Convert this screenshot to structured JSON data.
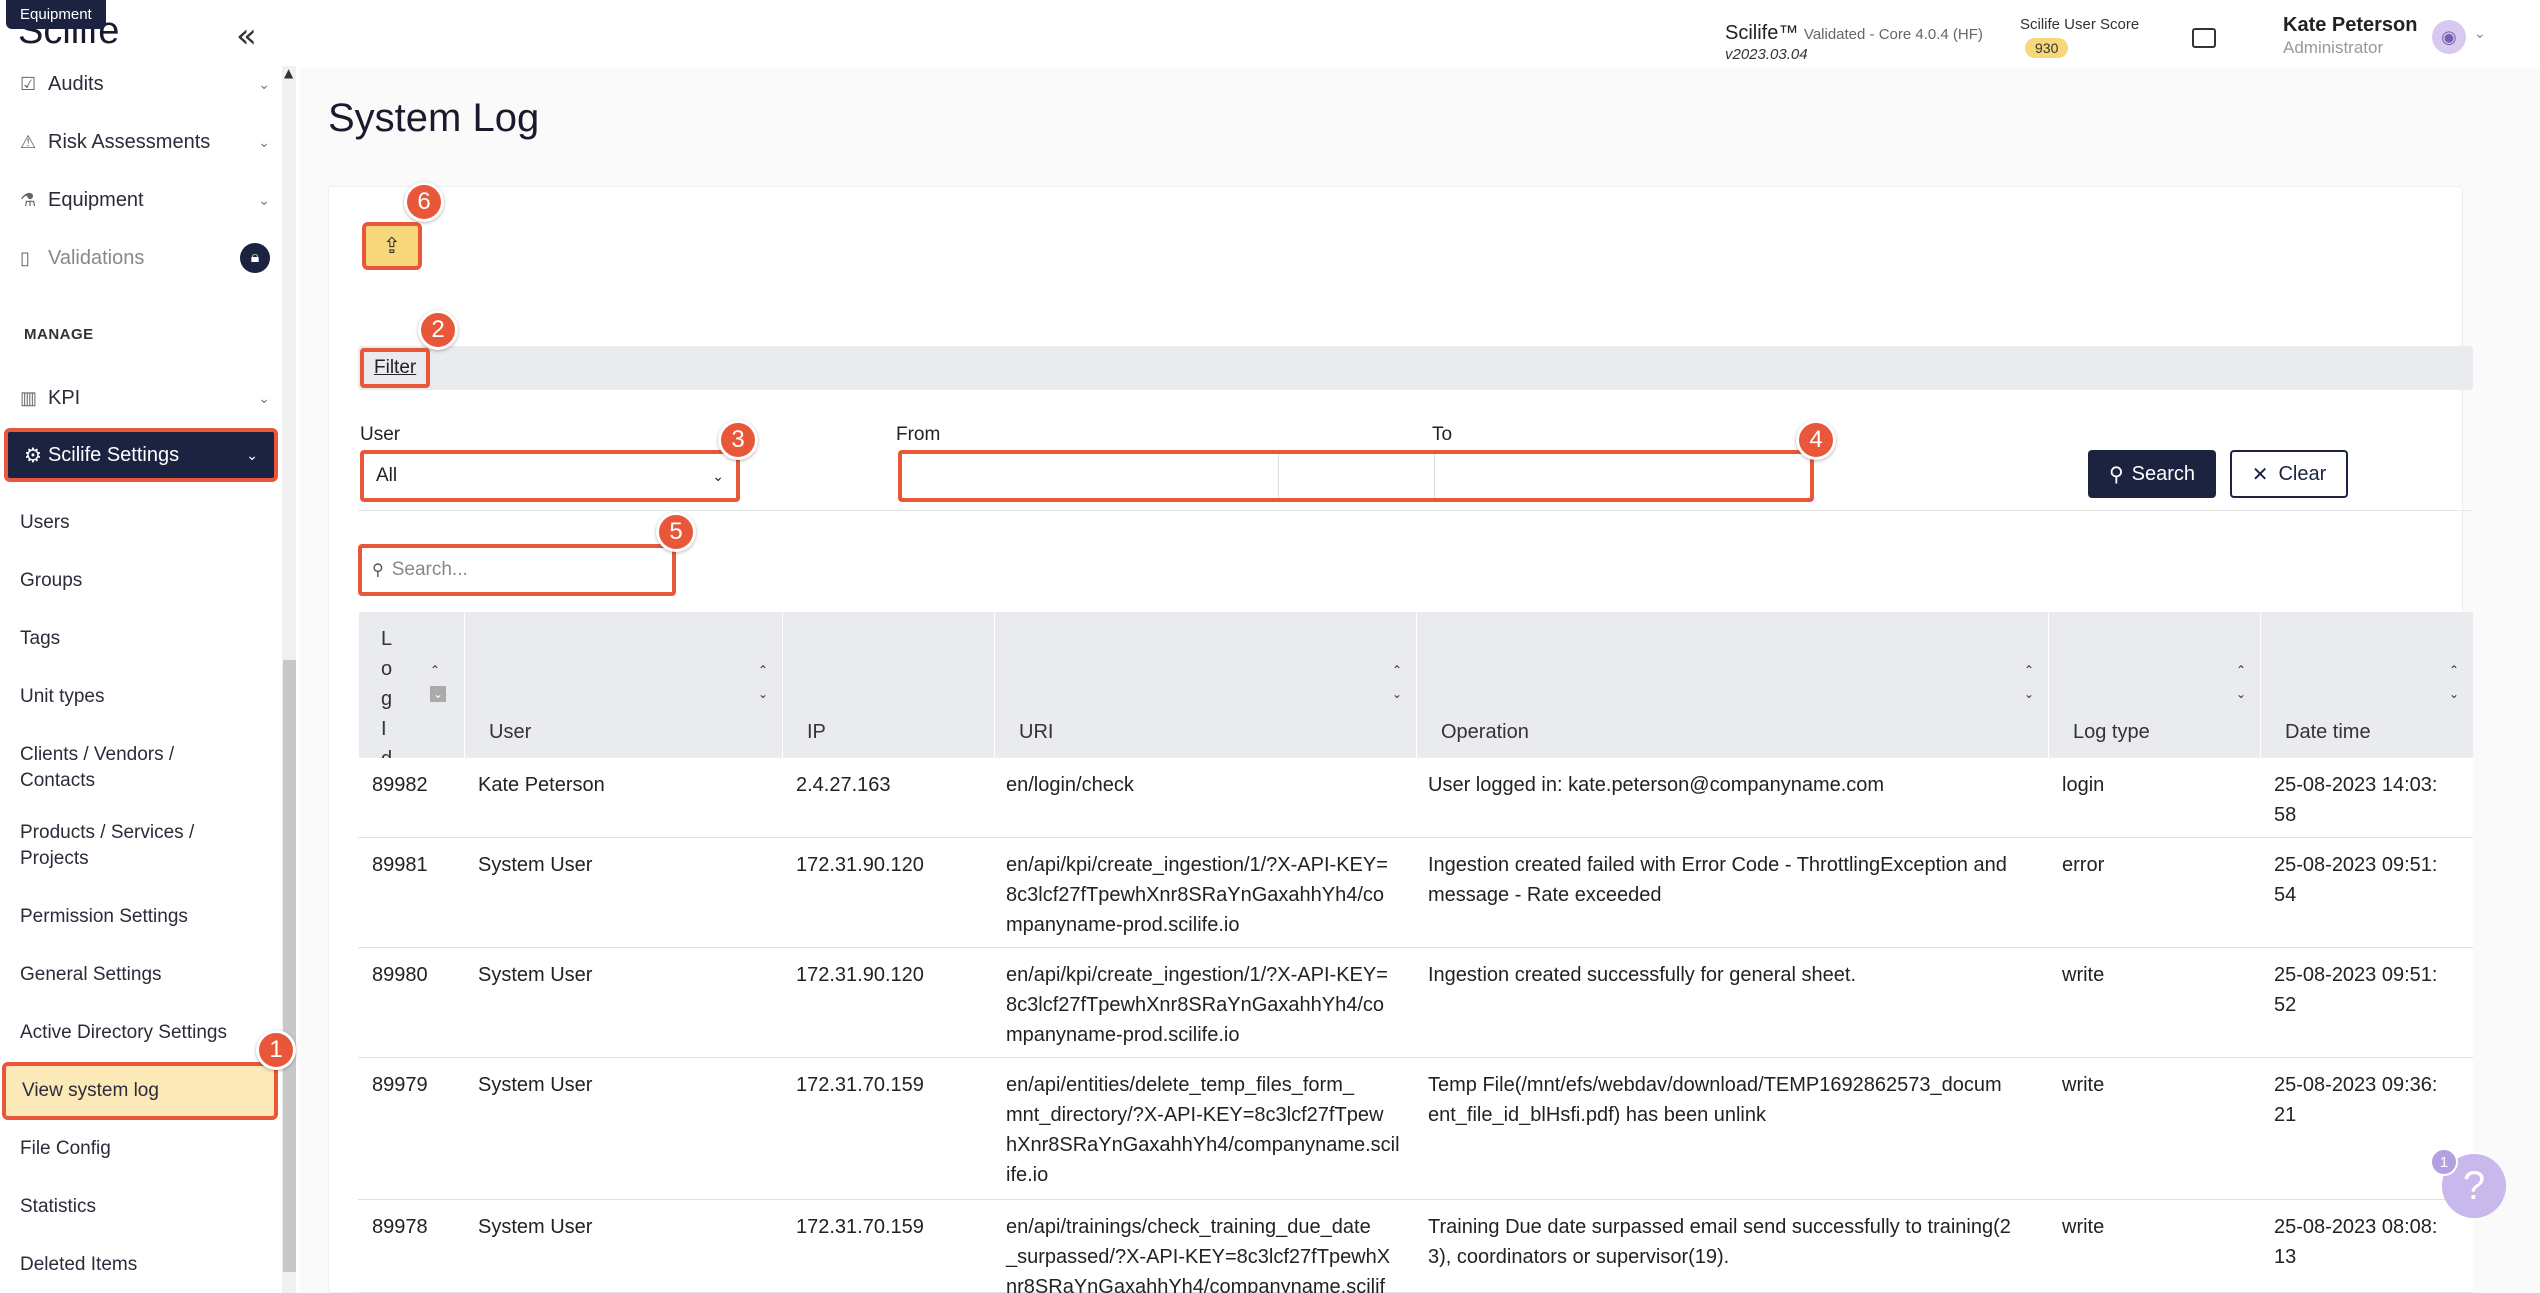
{
  "app": {
    "logo": "Scilife",
    "tooltip": "Equipment"
  },
  "sidebar": {
    "top_items": [
      {
        "label": "Audits"
      },
      {
        "label": "Risk Assessments"
      },
      {
        "label": "Equipment"
      },
      {
        "label": "Validations"
      }
    ],
    "section_label": "MANAGE",
    "kpi": "KPI",
    "settings": "Scilife Settings",
    "sub_items": [
      "Users",
      "Groups",
      "Tags",
      "Unit types",
      "Clients / Vendors / Contacts",
      "Products / Services / Projects",
      "Permission Settings",
      "General Settings",
      "Active Directory Settings",
      "View system log",
      "File Config",
      "Statistics",
      "Deleted Items"
    ]
  },
  "header": {
    "product": "Scilife™",
    "validated": "Validated - Core 4.0.4 (HF)",
    "version": "v2023.03.04",
    "score_label": "Scilife User Score",
    "score_value": "930",
    "user_name": "Kate Peterson",
    "user_role": "Administrator"
  },
  "page": {
    "title": "System Log",
    "filter_label": "Filter",
    "user_label": "User",
    "user_value": "All",
    "from_label": "From",
    "to_label": "To",
    "search_button": "Search",
    "clear_button": "Clear",
    "search_placeholder": "Search..."
  },
  "callouts": [
    "1",
    "2",
    "3",
    "4",
    "5",
    "6"
  ],
  "table": {
    "columns": [
      "Log Id",
      "User",
      "IP",
      "URI",
      "Operation",
      "Log type",
      "Date time"
    ],
    "rows": [
      {
        "id": "89982",
        "user": "Kate Peterson",
        "ip": "2.4.27.163",
        "uri": "en/login/check",
        "op": "User logged in: kate.peterson@companyname.com",
        "type": "login",
        "date": "25-08-2023 14:03:\n58"
      },
      {
        "id": "89981",
        "user": "System User",
        "ip": "172.31.90.120",
        "uri": "en/api/kpi/create_ingestion/1/?X-API-KEY=\n8c3lcf27fTpewhXnr8SRaYnGaxahhYh4/co\nmpanyname-prod.scilife.io",
        "op": "Ingestion created failed with Error Code - ThrottlingException and\nmessage - Rate exceeded",
        "type": "error",
        "date": "25-08-2023 09:51:\n54"
      },
      {
        "id": "89980",
        "user": "System User",
        "ip": "172.31.90.120",
        "uri": "en/api/kpi/create_ingestion/1/?X-API-KEY=\n8c3lcf27fTpewhXnr8SRaYnGaxahhYh4/co\nmpanyname-prod.scilife.io",
        "op": "Ingestion created successfully for general sheet.",
        "type": "write",
        "date": "25-08-2023 09:51:\n52"
      },
      {
        "id": "89979",
        "user": "System User",
        "ip": "172.31.70.159",
        "uri": "en/api/entities/delete_temp_files_form_\nmnt_directory/?X-API-KEY=8c3lcf27fTpew\nhXnr8SRaYnGaxahhYh4/companyname.scil\nife.io",
        "op": "Temp File(/mnt/efs/webdav/download/TEMP1692862573_docum\nent_file_id_blHsfi.pdf) has been unlink",
        "type": "write",
        "date": "25-08-2023 09:36:\n21"
      },
      {
        "id": "89978",
        "user": "System User",
        "ip": "172.31.70.159",
        "uri": "en/api/trainings/check_training_due_date\n_surpassed/?X-API-KEY=8c3lcf27fTpewhX\nnr8SRaYnGaxahhYh4/companyname.scilif",
        "op": "Training Due date surpassed email send successfully to training(2\n3), coordinators or supervisor(19).",
        "type": "write",
        "date": "25-08-2023 08:08:\n13"
      }
    ]
  },
  "help": {
    "count": "1",
    "symbol": "?"
  }
}
